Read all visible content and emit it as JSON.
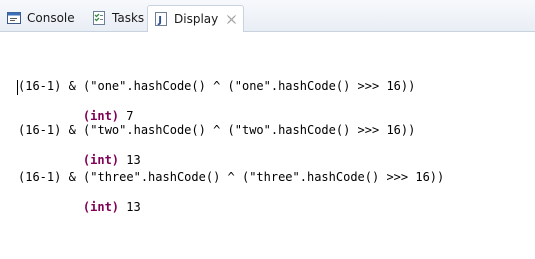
{
  "tabs": [
    {
      "label": "Console",
      "icon": "console-icon",
      "active": false
    },
    {
      "label": "Tasks",
      "icon": "tasks-icon",
      "active": false
    },
    {
      "label": "Display",
      "icon": "display-view-icon",
      "active": true,
      "closable": true
    }
  ],
  "display": {
    "entries": [
      {
        "expression": "(16-1) & (\"one\".hashCode() ^ (\"one\".hashCode() >>> 16))",
        "result_type": "(int)",
        "result_value": "7"
      },
      {
        "expression": "(16-1) & (\"two\".hashCode() ^ (\"two\".hashCode() >>> 16))",
        "result_type": "(int)",
        "result_value": "13"
      },
      {
        "expression": "(16-1) & (\"three\".hashCode() ^ (\"three\".hashCode() >>> 16))",
        "result_type": "(int)",
        "result_value": "13"
      }
    ]
  },
  "colors": {
    "keyword": "#7f0055",
    "tabbar_background": "#e9eef5",
    "text": "#000000"
  }
}
